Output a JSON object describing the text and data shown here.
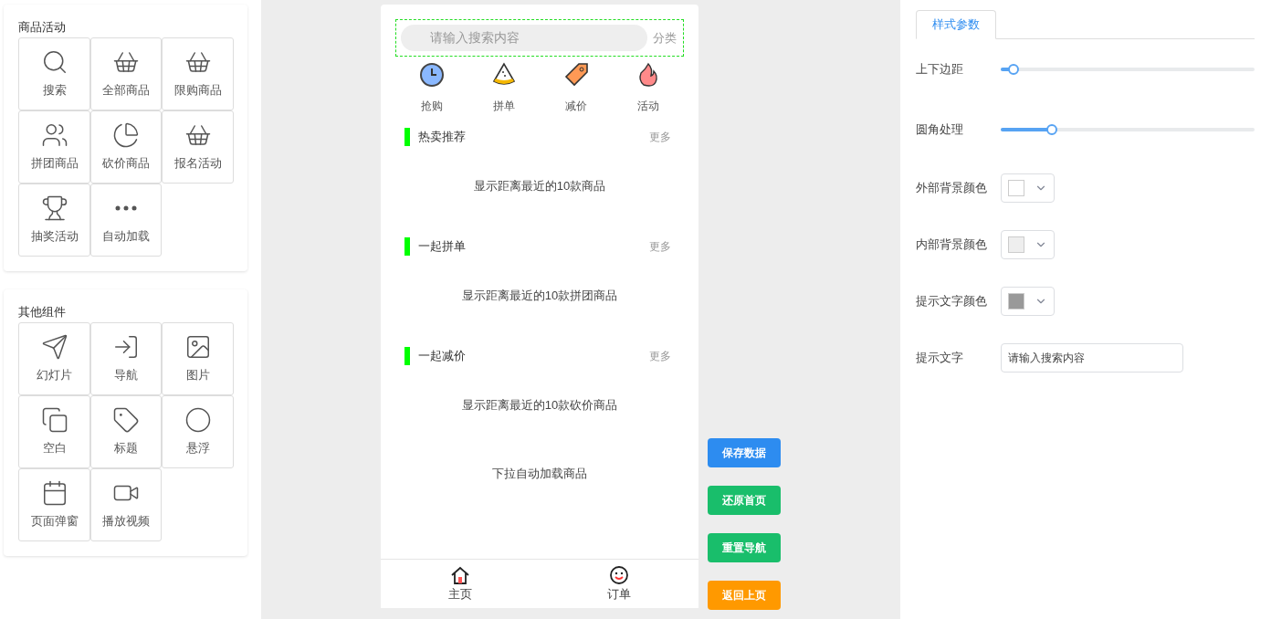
{
  "palette": [
    {
      "title": "商品活动",
      "items": [
        {
          "label": "搜索"
        },
        {
          "label": "全部商品"
        },
        {
          "label": "限购商品"
        },
        {
          "label": "拼团商品"
        },
        {
          "label": "砍价商品"
        },
        {
          "label": "报名活动"
        },
        {
          "label": "抽奖活动"
        },
        {
          "label": "自动加载"
        }
      ]
    },
    {
      "title": "其他组件",
      "items": [
        {
          "label": "幻灯片"
        },
        {
          "label": "导航"
        },
        {
          "label": "图片"
        },
        {
          "label": "空白"
        },
        {
          "label": "标题"
        },
        {
          "label": "悬浮"
        },
        {
          "label": "页面弹窗"
        },
        {
          "label": "播放视频"
        }
      ]
    }
  ],
  "phone": {
    "search": {
      "placeholder": "请输入搜索内容",
      "category": "分类"
    },
    "quick_nav": [
      {
        "label": "抢购"
      },
      {
        "label": "拼单"
      },
      {
        "label": "减价"
      },
      {
        "label": "活动"
      }
    ],
    "sections": [
      {
        "title": "热卖推荐",
        "more": "更多",
        "body": "显示距离最近的10款商品"
      },
      {
        "title": "一起拼单",
        "more": "更多",
        "body": "显示距离最近的10款拼团商品"
      },
      {
        "title": "一起减价",
        "more": "更多",
        "body": "显示距离最近的10款砍价商品"
      }
    ],
    "footer_text": "下拉自动加载商品",
    "tab_bar": [
      {
        "label": "主页"
      },
      {
        "label": "订单"
      }
    ]
  },
  "actions": [
    {
      "label": "保存数据",
      "color": "#2d8cf0"
    },
    {
      "label": "还原首页",
      "color": "#19be6b"
    },
    {
      "label": "重置导航",
      "color": "#19be6b"
    },
    {
      "label": "返回上页",
      "color": "#ff9900"
    }
  ],
  "settings": {
    "tabs": [
      {
        "label": "样式参数",
        "selected": true
      }
    ],
    "fields": [
      {
        "kind": "slider",
        "label": "上下边距",
        "level": 0.05
      },
      {
        "kind": "slider",
        "label": "圆角处理",
        "level": 0.2
      },
      {
        "kind": "color",
        "label": "外部背景颜色",
        "color": "#ffffff"
      },
      {
        "kind": "color",
        "label": "内部背景颜色",
        "color": "#eeeeee"
      },
      {
        "kind": "color",
        "label": "提示文字颜色",
        "color": "#999999"
      },
      {
        "kind": "text",
        "label": "提示文字",
        "value": "请输入搜索内容"
      }
    ]
  }
}
